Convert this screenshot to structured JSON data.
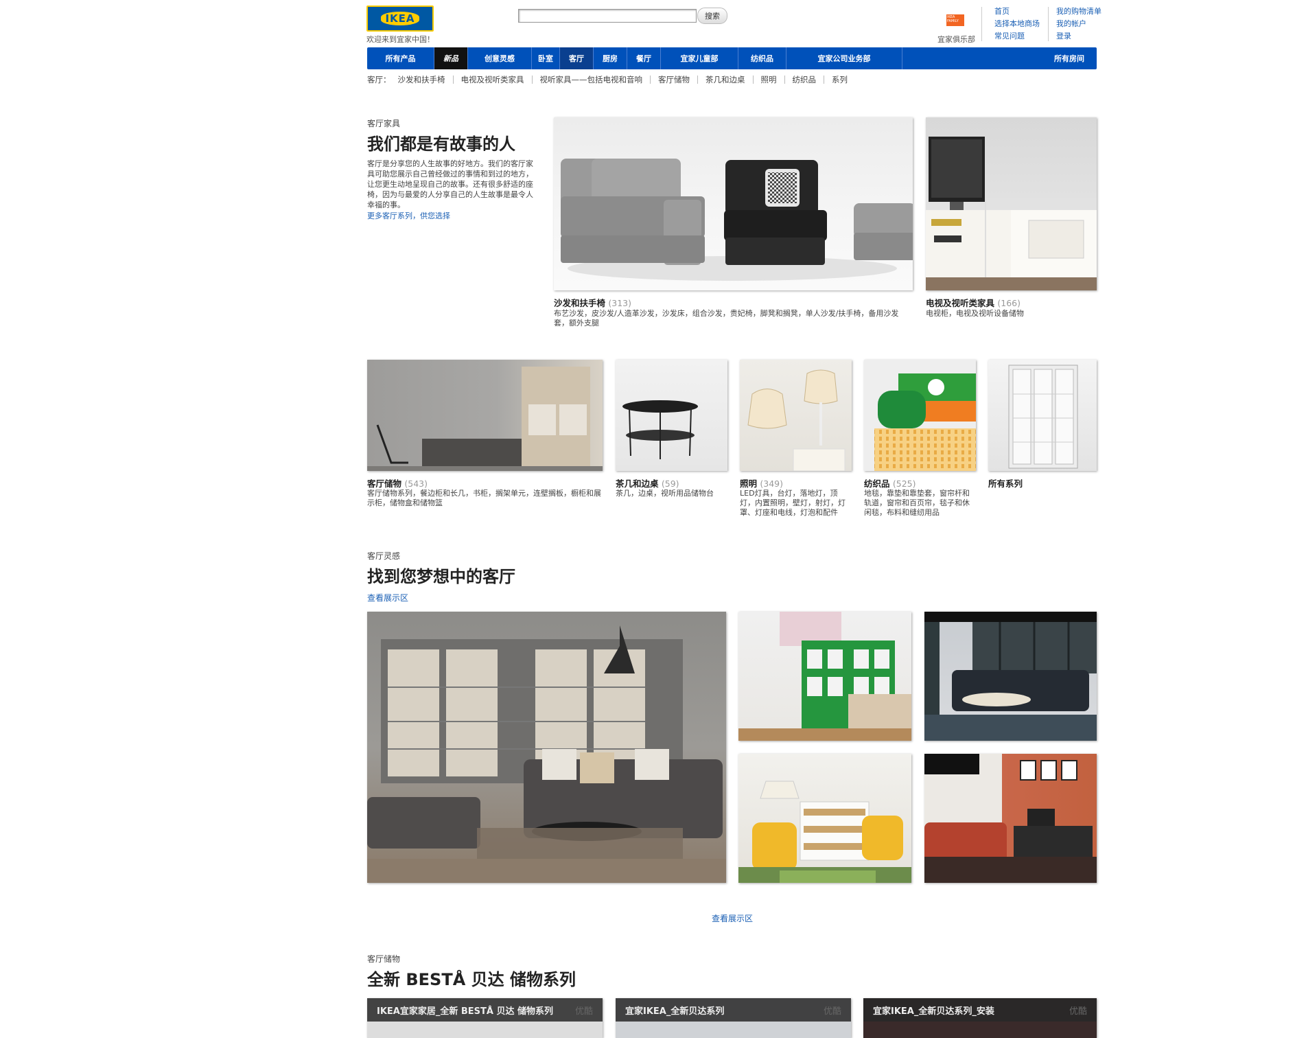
{
  "header": {
    "logo_text": "IKEA",
    "welcome": "欢迎来到宜家中国！",
    "search_placeholder": "",
    "search_button": "搜索",
    "family_badge": "IKEA FAMILY",
    "family_label": "宜家俱乐部",
    "links_col1": [
      "首页",
      "选择本地商场",
      "常见问题"
    ],
    "links_col2": [
      "我的购物清单",
      "我的帐户",
      "登录"
    ]
  },
  "nav": {
    "items": [
      "所有产品",
      "新品",
      "创意灵感",
      "卧室",
      "客厅",
      "厨房",
      "餐厅",
      "宜家儿童部",
      "纺织品",
      "宜家公司业务部"
    ],
    "all_rooms": "所有房间"
  },
  "subnav": {
    "prefix": "客厅：",
    "items": [
      "沙发和扶手椅",
      "电视及视听类家具",
      "视听家具——包括电视和音响",
      "客厅储物",
      "茶几和边桌",
      "照明",
      "纺织品",
      "系列"
    ]
  },
  "intro": {
    "label": "客厅家具",
    "title": "我们都是有故事的人",
    "text": "客厅是分享您的人生故事的好地方。我们的客厅家具可助您展示自己曾经做过的事情和到过的地方，让您更生动地呈现自己的故事。还有很多舒适的座椅，因为与最爱的人分享自己的人生故事是最令人幸福的事。",
    "link": "更多客厅系列，供您选择"
  },
  "featured": [
    {
      "name": "沙发和扶手椅",
      "count": "(313)",
      "desc": "布艺沙发，皮沙发/人造革沙发，沙发床，组合沙发，贵妃椅，脚凳和搁凳，单人沙发/扶手椅，备用沙发套，额外支腿"
    },
    {
      "name": "电视及视听类家具",
      "count": "(166)",
      "desc": "电视柜，电视及视听设备储物"
    }
  ],
  "categories": [
    {
      "name": "客厅储物",
      "count": "(543)",
      "desc": "客厅储物系列，餐边柜和长几，书柜，搁架单元，连壁搁板，橱柜和展示柜，储物盒和储物篮"
    },
    {
      "name": "茶几和边桌",
      "count": "(59)",
      "desc": "茶几，边桌，视听用品储物台"
    },
    {
      "name": "照明",
      "count": "(349)",
      "desc": "LED灯具，台灯，落地灯，顶灯，内置照明，壁灯，射灯，灯罩、灯座和电线，灯泡和配件"
    },
    {
      "name": "纺织品",
      "count": "(525)",
      "desc": "地毯，靠垫和靠垫套，窗帘杆和轨道，窗帘和百页帘，毯子和休闲毯，布料和缝纫用品"
    },
    {
      "name": "所有系列",
      "count": "",
      "desc": ""
    }
  ],
  "inspiration": {
    "label": "客厅灵感",
    "title": "找到您梦想中的客厅",
    "link": "查看展示区",
    "bottom_link": "查看展示区"
  },
  "storage": {
    "label": "客厅储物",
    "title": "全新 BESTÅ 贝达 储物系列",
    "videos": [
      {
        "title": "IKEA宜家家居_全新 BESTÅ 贝达 储物系列",
        "badge": "优酷"
      },
      {
        "title": "宜家IKEA_全新贝达系列",
        "badge": "优酷"
      },
      {
        "title": "宜家IKEA_全新贝达系列_安装",
        "badge": "优酷"
      }
    ]
  },
  "colors": {
    "nav_blue": "#0051ba",
    "logo_yellow": "#ffcc00",
    "link_blue": "#1a5fb4"
  }
}
